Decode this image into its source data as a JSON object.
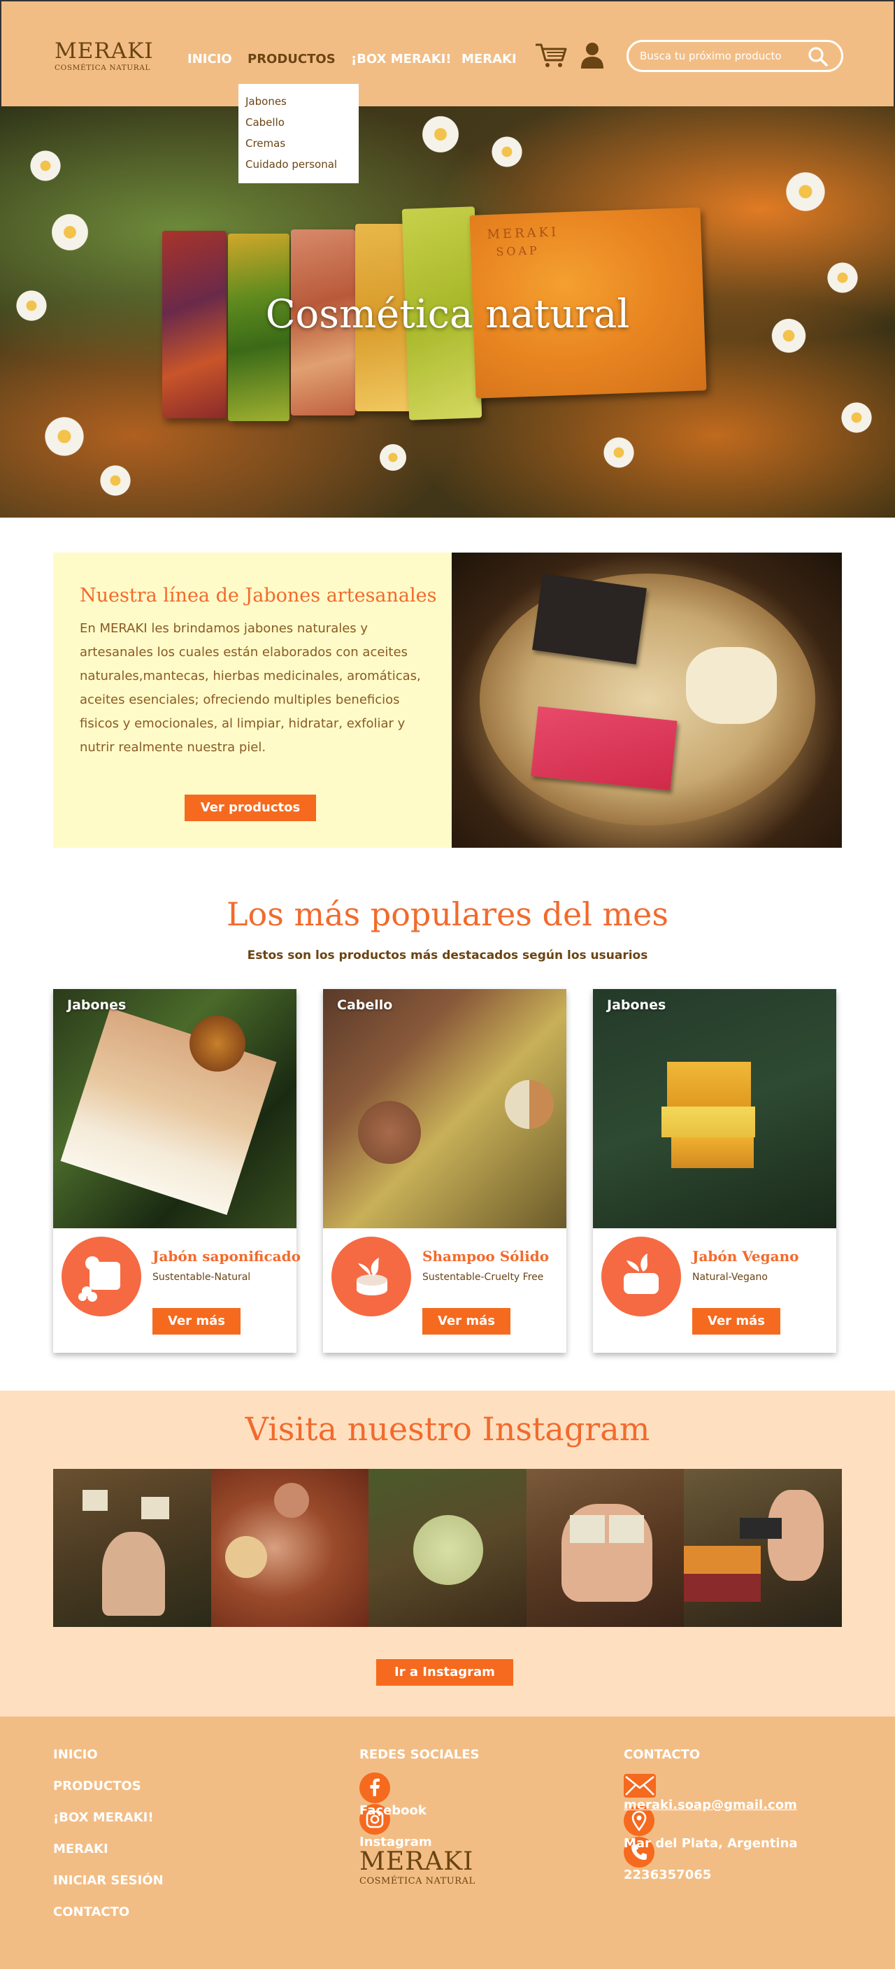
{
  "header": {
    "logo_brand": "MERAKI",
    "logo_tag": "COSMÉTICA NATURAL",
    "nav": [
      {
        "label": "INICIO",
        "active": false
      },
      {
        "label": "PRODUCTOS",
        "active": true
      },
      {
        "label": "¡BOX MERAKI!",
        "active": false
      },
      {
        "label": "MERAKI",
        "active": false
      }
    ],
    "search_placeholder": "Busca tu próximo producto"
  },
  "dropdown": {
    "items": [
      "Jabones",
      "Cabello",
      "Cremas",
      "Cuidado personal"
    ]
  },
  "hero": {
    "title": "Cosmética natural",
    "soap_stamp_1": "MERAKI",
    "soap_stamp_2": "SOAP"
  },
  "line": {
    "title": "Nuestra línea de Jabones artesanales",
    "body": "En MERAKI les brindamos jabones naturales y artesanales los cuales están elaborados con aceites naturales,mantecas, hierbas medicinales, aromáticas, aceites esenciales; ofreciendo multiples beneficios fisicos y emocionales, al limpiar, hidratar, exfoliar y nutrir realmente nuestra piel.",
    "button": "Ver productos"
  },
  "popular": {
    "title": "Los más populares del mes",
    "subtitle": "Estos son los productos más destacados según los usuarios",
    "cards": [
      {
        "category": "Jabones",
        "name": "Jabón saponificado",
        "desc": "Sustentable-Natural",
        "button": "Ver más",
        "icon": "soap-flower-icon"
      },
      {
        "category": "Cabello",
        "name": "Shampoo Sólido",
        "desc": "Sustentable-Cruelty Free",
        "button": "Ver más",
        "icon": "shampoo-bar-icon"
      },
      {
        "category": "Jabones",
        "name": "Jabón Vegano",
        "desc": "Natural-Vegano",
        "button": "Ver más",
        "icon": "vegan-soap-icon"
      }
    ]
  },
  "instagram": {
    "title": "Visita nuestro Instagram",
    "button": "Ir a Instagram"
  },
  "footer": {
    "nav": [
      "INICIO",
      "PRODUCTOS",
      "¡BOX MERAKI!",
      "MERAKI",
      "INICIAR SESIÓN",
      "CONTACTO"
    ],
    "social_heading": "REDES SOCIALES",
    "facebook": "Facebook",
    "instagram": "Instagram",
    "contact_heading": "CONTACTO",
    "email": "meraki.soap@gmail.com",
    "location": "Mar del Plata, Argentina",
    "phone": "2236357065",
    "logo_brand": "MERAKI",
    "logo_tag": "COSMÉTICA NATURAL"
  },
  "colors": {
    "header_bg": "#f2bd84",
    "accent": "#f26a2c",
    "button": "#f56a1e",
    "cream": "#fefbc9",
    "peach": "#fee0c0",
    "brown": "#6b4413"
  }
}
